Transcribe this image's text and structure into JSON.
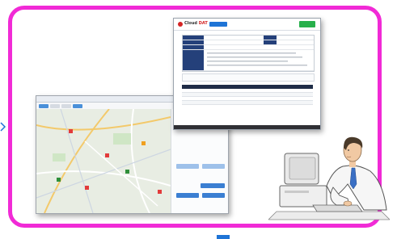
{
  "map_window": {
    "title": "",
    "toolbar_chips": [
      "",
      "",
      "",
      ""
    ],
    "side_buttons": [
      "",
      "",
      "",
      "",
      ""
    ]
  },
  "cloud_window": {
    "logo_text": "Cloud",
    "logo_accent": "DAT",
    "nav_items": [
      "",
      "",
      ""
    ],
    "form_values": [
      "",
      "",
      ""
    ],
    "footer_text": ""
  },
  "colors": {
    "frame": "#f12ad6",
    "brand_blue": "#1e74d6",
    "header_navy": "#24407a",
    "brand_red": "#d42424",
    "go_green": "#27b04b"
  },
  "icons": [
    "left-arrow-icon",
    "map-marker-icon",
    "logo-mark-icon"
  ]
}
